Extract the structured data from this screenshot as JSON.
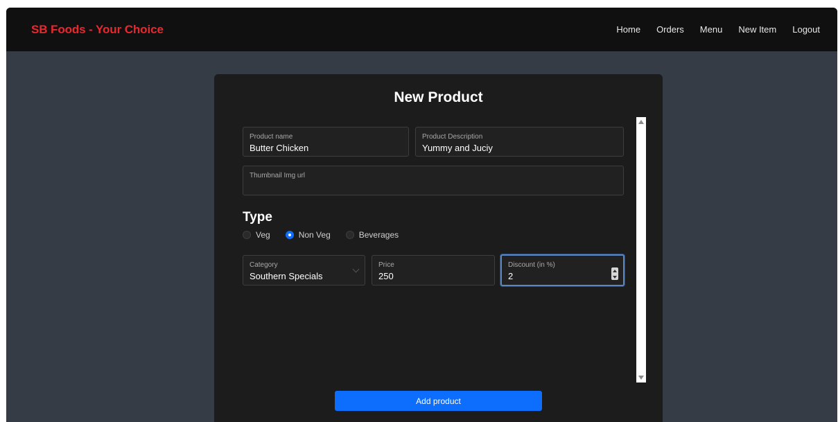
{
  "navbar": {
    "brand": "SB Foods - Your Choice",
    "links": [
      "Home",
      "Orders",
      "Menu",
      "New Item",
      "Logout"
    ]
  },
  "form": {
    "title": "New Product",
    "product_name": {
      "label": "Product name",
      "value": "Butter Chicken"
    },
    "product_description": {
      "label": "Product Description",
      "value": "Yummy and Juciy"
    },
    "thumbnail": {
      "label": "Thumbnail Img url",
      "value": ""
    },
    "type": {
      "heading": "Type",
      "options": [
        "Veg",
        "Non Veg",
        "Beverages"
      ],
      "selected": "Non Veg"
    },
    "category": {
      "label": "Category",
      "value": "Southern Specials"
    },
    "price": {
      "label": "Price",
      "value": "250"
    },
    "discount": {
      "label": "Discount (in %)",
      "value": "2"
    },
    "submit_label": "Add product"
  },
  "icons": {
    "category_dropdown": "chevron-down-icon",
    "discount_stepper": "stepper-icon",
    "scroll_up": "triangle-up-icon",
    "scroll_down": "triangle-down-icon"
  },
  "colors": {
    "brand": "#e8282f",
    "accent": "#0d6efd",
    "navbar_bg": "#101010",
    "page_bg": "#353c46",
    "card_bg": "#1c1c1c"
  }
}
